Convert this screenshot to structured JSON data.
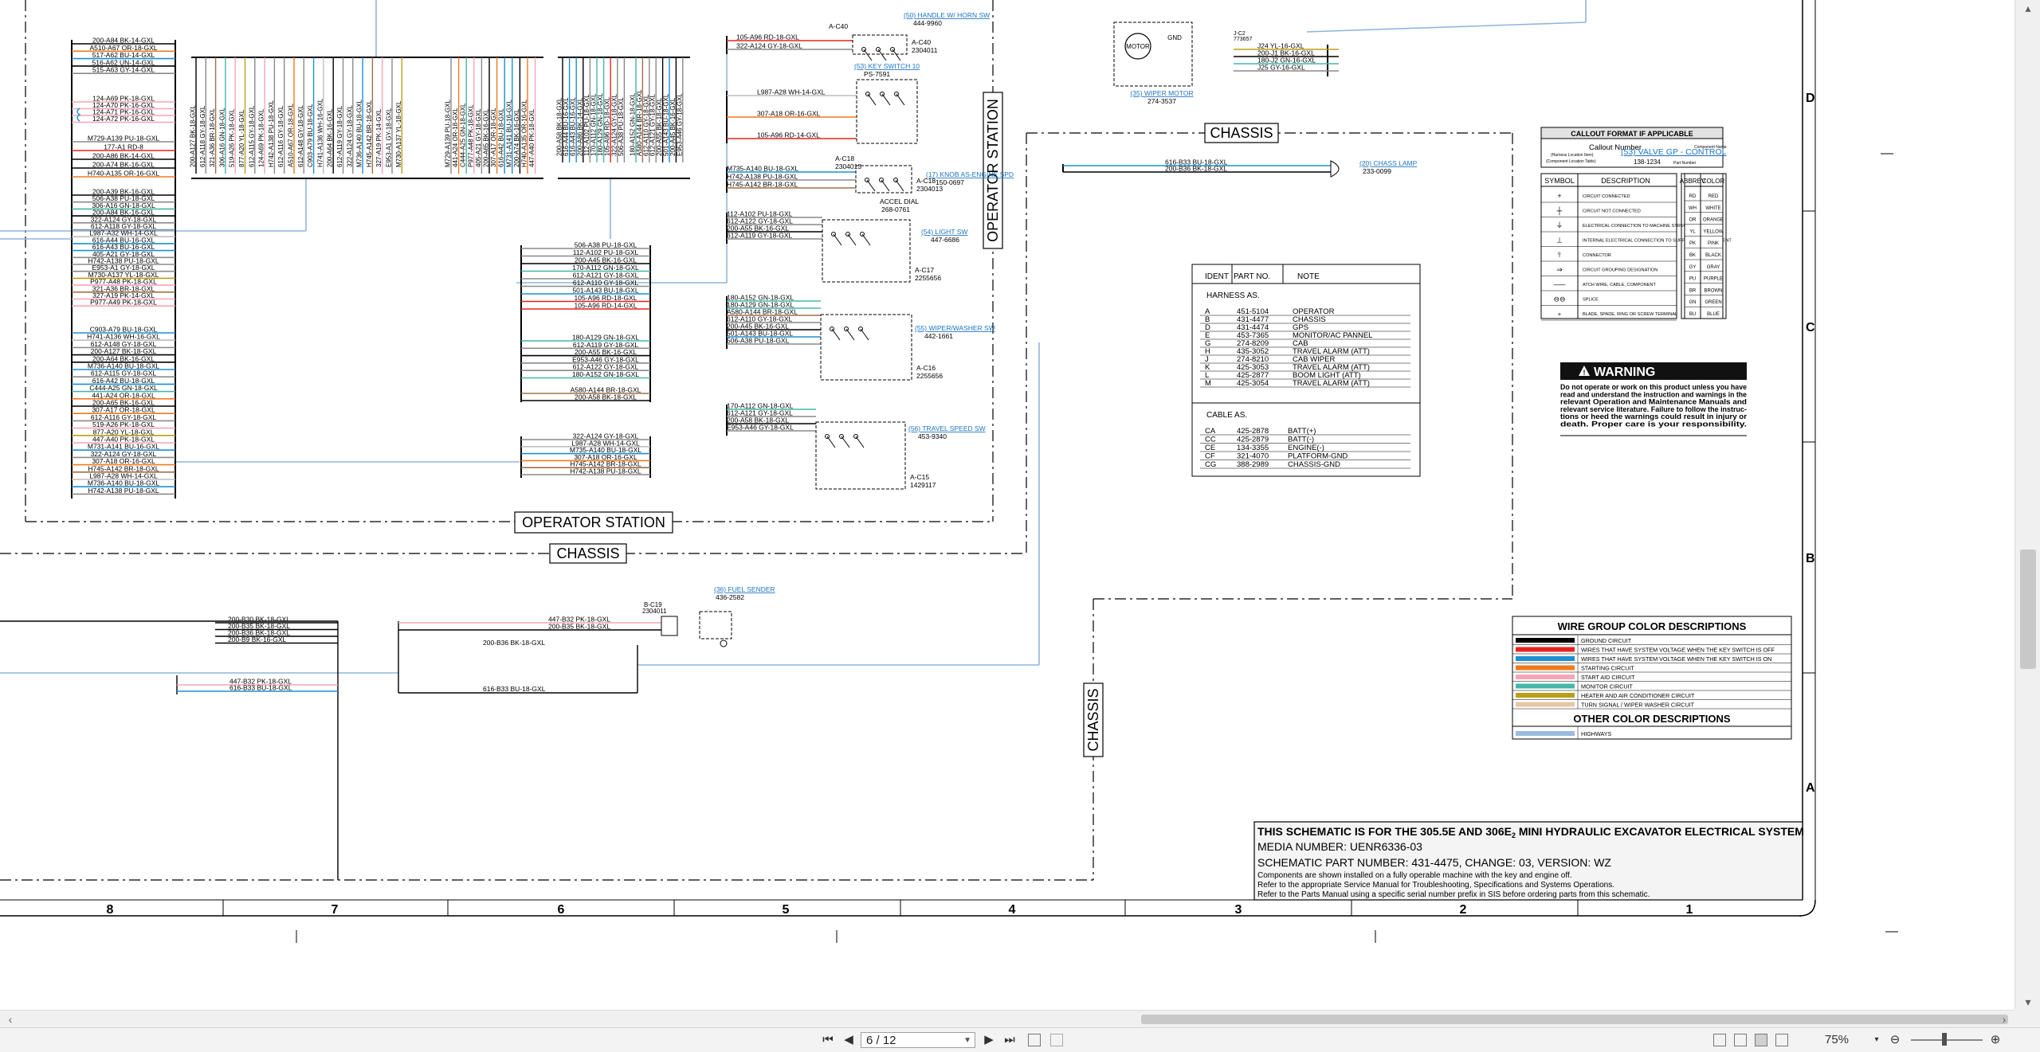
{
  "viewer": {
    "page_current": "6",
    "page_total": "12",
    "page_display": "6 / 12",
    "zoom": "75%",
    "buttons": {
      "first": "⏮",
      "prev": "◀",
      "next": "▶",
      "last": "⏭",
      "zoom_out": "⊖",
      "zoom_in": "⊕"
    }
  },
  "schematic": {
    "sections": {
      "operator_station": "OPERATOR STATION",
      "chassis": "CHASSIS"
    },
    "zones": {
      "d": "D",
      "c": "C",
      "b": "B",
      "a": "A"
    },
    "columns": [
      "8",
      "7",
      "6",
      "5",
      "4",
      "3",
      "2",
      "1"
    ],
    "left_connector_a": [
      "200-A84 BK-14-GXL",
      "A510-A67 OR-18-GXL",
      "517-A62 BU-14-GXL",
      "516-A62 UN-14-GXL",
      "515-A63 GY-14-GXL"
    ],
    "left_connector_b": [
      "124-A69 PK-18-GXL",
      "124-A70 PK-16-GXL",
      "124-A71 PK-16-GXL",
      "124-A72 PK-16-GXL"
    ],
    "left_connector_c": [
      "M729-A139 PU-18-GXL",
      "177-A1 RD-8",
      "200-A86 BK-14-GXL",
      "200-A74 BK-16-GXL",
      "H740-A135 OR-16-GXL"
    ],
    "left_connector_d": [
      "200-A39 BK-16-GXL",
      "506-A38 PU-18-GXL",
      "306-A16 GN-18-GXL",
      "200-A84 BK-16-GXL",
      "322-A124 GY-18-GXL",
      "612-A118 GY-18-GXL",
      "L987-A32 WH-14-GXL",
      "616-A44 BU-16-GXL",
      "616-A43 BU-16-GXL",
      "405-A21 GY-18-GXL",
      "H742-A138 PU-18-GXL",
      "E953-A1 GY-18-GXL",
      "M730-A137 YL-18-GXL",
      "P977-A48 PK-18-GXL",
      "321-A36 BR-18-GXL",
      "327-A19 PK-14-GXL",
      "P977-A49 PK-18-GXL"
    ],
    "left_connector_e": [
      "C903-A79 BU-18-GXL",
      "H741-A136 WH-16-GXL",
      "612-A148 GY-18-GXL",
      "200-A127 BK-18-GXL",
      "200-A64 BK-16-GXL",
      "M736-A140 BU-18-GXL",
      "612-A115 GY-18-GXL",
      "616-A42 BU-18-GXL",
      "C444-A25 GN-18-GXL",
      "441-A24 OR-18-GXL",
      "200-A65 BK-16-GXL",
      "307-A17 OR-18-GXL",
      "612-A116 GY-18-GXL",
      "519-A26 PK-18-GXL",
      "877-A20 YL-18-GXL",
      "447-A40 PK-18-GXL",
      "M731-A141 BU-16-GXL",
      "322-A124 GY-18-GXL",
      "307-A18 OR-16-GXL",
      "H745-A142 BR-18-GXL",
      "L987-A28 WH-14-GXL",
      "M736-A140 BU-18-GXL",
      "H742-A138 PU-18-GXL"
    ],
    "top_bundle_a": [
      "200-A127 BK-18-GXL",
      "612-A118 GY-18-GXL",
      "321-A36 BR-18-GXL",
      "306-A16 GN-18-GXL",
      "519-A26 PK-18-GXL",
      "877-A20 YL-18-GXL",
      "612-A115 GY-18-GXL",
      "124-A69 PK-18-GXL",
      "H742-A138 PU-18-GXL",
      "612-A116 GY-18-GXL",
      "A510-A67 OR-18-GXL",
      "612-A148 GY-18-GXL",
      "C903-A79 BU-18-GXL",
      "H741-A136 WH-16-GXL",
      "200-A64 BK-16-GXL",
      "612-A119 GY-18-GXL",
      "322-A124 GY-18-GXL",
      "M736-A140 BU-18-GXL",
      "H745-A142 BR-18-GXL",
      "327-A19 PK-14-GXL",
      "E953-A1 GY-18-GXL",
      "M730-A137 YL-18-GXL"
    ],
    "top_bundle_b": [
      "M729-A139 PU-18-GXL",
      "441-A24 OR-18-GXL",
      "C444-A25 GN-18-GXL",
      "P977-A48 PK-18-GXL",
      "405-A21 GY-18-GXL",
      "200-A65 BK-16-GXL",
      "307-A17 OR-18-GXL",
      "616-A42 BU-18-GXL",
      "M731-A141 BU-16-GXL",
      "200-A74 BK-16-GXL",
      "H740-A135 OR-16-GXL",
      "447-A40 PK-18-GXL"
    ],
    "top_bundle_c": [
      "200-A58 BK-18-GXL",
      "616-A44 BU-16-GXL",
      "616-A43 BU-16-GXL",
      "200-A86 BK-14-GXL",
      "112-A102 PU-18-GXL",
      "170-A112 GN-18-GXL",
      "180-A129 GN-18-GXL",
      "105-A96 RD-18-GXL",
      "322-A124 GY-18-GXL",
      "506-A38 PU-18-GXL"
    ],
    "top_bundle_d": [
      "180-A152 GN-18-GXL",
      "A580-A144 BR-18-GXL",
      "612-A110 GY-18-GXL",
      "612-A121 GY-18-GXL",
      "200-A55 BK-18-GXL",
      "501-A143 BU-18-GXL",
      "200-A45 BK-16-GXL",
      "E953-A46 GY-18-GXL"
    ],
    "mid_connector_a": [
      "506-A38 PU-18-GXL",
      "112-A102 PU-18-GXL",
      "200-A45 BK-16-GXL",
      "170-A112 GN-18-GXL",
      "612-A121 GY-18-GXL",
      "612-A110 GY-18-GXL",
      "501-A143 BU-18-GXL",
      "105-A96 RD-18-GXL",
      "105-A96 RD-14-GXL"
    ],
    "mid_connector_b": [
      "180-A129 GN-18-GXL",
      "612-A119 GY-18-GXL",
      "200-A55 BK-16-GXL",
      "E953-A46 GY-18-GXL",
      "612-A122 GY-18-GXL",
      "180-A152 GN-18-GXL"
    ],
    "mid_connector_c": [
      "A580-A144 BR-18-GXL",
      "200-A58 BK-18-GXL"
    ],
    "mid_connector_d": [
      "322-A124 GY-18-GXL",
      "L987-A28 WH-14-GXL",
      "M735-A140 BU-18-GXL",
      "307-A18 OR-16-GXL",
      "H745-A142 BR-18-GXL",
      "H742-A138 PU-18-GXL"
    ],
    "horn_sw": {
      "title": "(50) HANDLE W/ HORN SW",
      "part": "444-9960",
      "conn": "A-C40",
      "conn_part": "2304011",
      "wires": [
        "105-A96 RD-18-GXL",
        "322-A124 GY-18-GXL"
      ]
    },
    "key_switch": {
      "title": "(53) KEY SWITCH 10",
      "part": "PS-7591",
      "wires": [
        "L987-A28 WH-14-GXL",
        "307-A18 OR-16-GXL",
        "105-A96 RD-14-GXL"
      ]
    },
    "knob_engine": {
      "title": "(17) KNOB AS-ENGINE SPD",
      "part": "150-0697",
      "conn": "A-C18",
      "conn_part": "2304013",
      "accel_dial": "ACCEL DIAL",
      "accel_part": "268-0761",
      "wires": [
        "M735-A140 BU-18-GXL",
        "H742-A138 PU-18-GXL",
        "H745-A142 BR-18-GXL"
      ]
    },
    "light_sw": {
      "title": "(54) LIGHT SW",
      "part": "447-6686",
      "conn": "A-C17",
      "conn_part": "2255656",
      "wires": [
        "112-A102 PU-18-GXL",
        "612-A122 GY-18-GXL",
        "200-A55 BK-16-GXL",
        "612-A119 GY-18-GXL"
      ]
    },
    "wiper_sw": {
      "title": "(55) WIPER/WASHER SW",
      "part": "442-1661",
      "conn": "A-C16",
      "conn_part": "2255656",
      "wires": [
        "180-A152 GN-18-GXL",
        "180-A129 GN-18-GXL",
        "A580-A144 BR-18-GXL",
        "612-A110 GY-18-GXL",
        "200-A45 BK-16-GXL",
        "501-A143 BU-18-GXL",
        "506-A38 PU-18-GXL"
      ]
    },
    "travel_speed_sw": {
      "title": "(56) TRAVEL SPEED SW",
      "part": "453-9340",
      "conn": "A-C15",
      "conn_part": "1429117",
      "wires": [
        "170-A112 GN-18-GXL",
        "612-A121 GY-18-GXL",
        "200-A58 BK-18-GXL",
        "E953-A46 GY-18-GXL"
      ]
    },
    "wiper_motor": {
      "title": "(35) WIPER MOTOR",
      "part": "274-3537",
      "conn": "J-C2",
      "conn_part": "773657",
      "motor": "MOTOR",
      "gnd": "GND",
      "wires": [
        "J24 YL-16-GXL",
        "200-J1 BK-16-GXL",
        "180-J2 GN-16-GXL",
        "J25 GY-16-GXL"
      ]
    },
    "cab_lamp": {
      "title": "(20) CHASS LAMP",
      "part": "233-0099",
      "wires": [
        "616-B33 BU-18-GXL",
        "200-B36 BK-18-GXL"
      ]
    },
    "fuel_sender": {
      "title": "(36) FUEL SENDER",
      "part": "436-2582",
      "conn": "B-C19",
      "conn_part": "2304011",
      "wires": [
        "447-B32 PK-18-GXL",
        "200-B35 BK-18-GXL"
      ]
    },
    "chassis_bundle": [
      "200-B30 BK-18-GXL",
      "200-B35 BK-18-GXL",
      "200-B36 BK-18-GXL",
      "200-B9 BK-16-GXL"
    ],
    "chassis_bottom": [
      "447-B32 PK-18-GXL",
      "616-B33 BU-18-GXL"
    ],
    "chassis_mid": [
      "200-B36 BK-18-GXL",
      "616-B33 BU-18-GXL"
    ],
    "ident_table": {
      "headers": [
        "IDENT",
        "PART NO.",
        "NOTE"
      ],
      "harness_title": "HARNESS AS.",
      "harness": [
        [
          "A",
          "451-5104",
          "OPERATOR"
        ],
        [
          "B",
          "431-4477",
          "CHASSIS"
        ],
        [
          "D",
          "431-4474",
          "GPS"
        ],
        [
          "E",
          "453-7365",
          "MONITOR/AC PANNEL"
        ],
        [
          "G",
          "274-8209",
          "CAB"
        ],
        [
          "H",
          "435-3052",
          "TRAVEL ALARM  (ATT)"
        ],
        [
          "J",
          "274-8210",
          "CAB WIPER"
        ],
        [
          "K",
          "425-3053",
          "TRAVEL ALARM  (ATT)"
        ],
        [
          "L",
          "425-2877",
          "BOOM LIGHT  (ATT)"
        ],
        [
          "M",
          "425-3054",
          "TRAVEL ALARM  (ATT)"
        ]
      ],
      "cable_title": "CABLE AS.",
      "cable": [
        [
          "CA",
          "425-2878",
          "BATT(+)"
        ],
        [
          "CC",
          "425-2879",
          "BATT(-)"
        ],
        [
          "CE",
          "134-3355",
          "ENGINE(-)"
        ],
        [
          "CF",
          "321-4070",
          "PLATFORM-GND"
        ],
        [
          "CG",
          "388-2989",
          "CHASSIS-GND"
        ]
      ]
    },
    "callout": {
      "title": "CALLOUT FORMAT IF APPLICABLE",
      "callout_number": "Callout Number",
      "callout_sub": "(Harness Location Item)",
      "component_location": "(Component Location Table)",
      "example": "(53) VALVE GP - CONTROL",
      "example_part": "138-1234",
      "component_name": "Component Name",
      "part_number": "Part Number",
      "symbols_header": [
        "SYMBOL",
        "DESCRIPTION"
      ],
      "symbols": [
        "CIRCUIT CONNECTED",
        "CIRCUIT NOT CONNECTED",
        "ELECTRICAL CONNECTION TO MACHINE STRUCTURE",
        "INTERNAL ELECTRICAL CONNECTION TO SURFACE OF COMPONENT",
        "CONNECTOR",
        "CIRCUIT GROUPING DESIGNATION",
        "ATCH WIRE, CABLE, COMPONENT",
        "SPLICE",
        "BLADE, SPADE, RING OR SCREW TERMINAL"
      ],
      "colors_header": [
        "ABBREV",
        "COLOR"
      ],
      "colors": [
        [
          "RD",
          "RED"
        ],
        [
          "WH",
          "WHITE"
        ],
        [
          "OR",
          "ORANGE"
        ],
        [
          "YL",
          "YELLOW"
        ],
        [
          "PK",
          "PINK"
        ],
        [
          "BK",
          "BLACK"
        ],
        [
          "GY",
          "GRAY"
        ],
        [
          "PU",
          "PURPLE"
        ],
        [
          "BR",
          "BROWN"
        ],
        [
          "GN",
          "GREEN"
        ],
        [
          "BU",
          "BLUE"
        ]
      ]
    },
    "warning": {
      "title": "WARNING",
      "text": [
        "Do not operate or work on this product unless you have",
        "read and understand the instruction and warnings in the",
        "relevant Operation and Maintenance Manuals and",
        "relevant service literature. Failure to follow the instruc-",
        "tions or heed the warnings could result in injury or",
        "death. Proper care is your responsibility."
      ]
    },
    "wire_groups": {
      "title": "WIRE GROUP COLOR DESCRIPTIONS",
      "items": [
        {
          "label": "GROUND CIRCUIT",
          "color": "#000000"
        },
        {
          "label": "WIRES THAT HAVE SYSTEM VOLTAGE WHEN THE KEY SWITCH IS OFF",
          "color": "#e8231f"
        },
        {
          "label": "WIRES THAT HAVE SYSTEM VOLTAGE WHEN THE KEY SWITCH IS ON",
          "color": "#1d8fd1"
        },
        {
          "label": "STARTING CIRCUIT",
          "color": "#f07a1c"
        },
        {
          "label": "START AID CIRCUIT",
          "color": "#f4a5b9"
        },
        {
          "label": "MONITOR CIRCUIT",
          "color": "#44b7a8"
        },
        {
          "label": "HEATER AND AIR CONDITIONER CIRCUIT",
          "color": "#b9a016"
        },
        {
          "label": "TURN SIGNAL / WIPER WASHER CIRCUIT",
          "color": "#e7c7a6"
        }
      ],
      "other_title": "OTHER COLOR DESCRIPTIONS",
      "other_items": [
        {
          "label": "HIGHWAYS",
          "color": "#9bbbe0"
        }
      ]
    },
    "title_block": {
      "line1": "THIS SCHEMATIC IS FOR THE 305.5E AND 306E",
      "line1_sub": "2",
      "line1_end": " MINI HYDRAULIC EXCAVATOR ELECTRICAL SYSTEM",
      "media": "MEDIA NUMBER: UENR6336-03",
      "part": "SCHEMATIC PART NUMBER: 431-4475, CHANGE: 03, VERSION: WZ",
      "note1": "Components are shown installed on a fully operable machine with the key and engine off.",
      "note2": "Refer to the appropriate Service Manual for Troubleshooting, Specifications and Systems Operations.",
      "note3": "Refer to the Parts Manual using a specific serial number prefix in SIS before ordering parts from this schematic."
    }
  }
}
